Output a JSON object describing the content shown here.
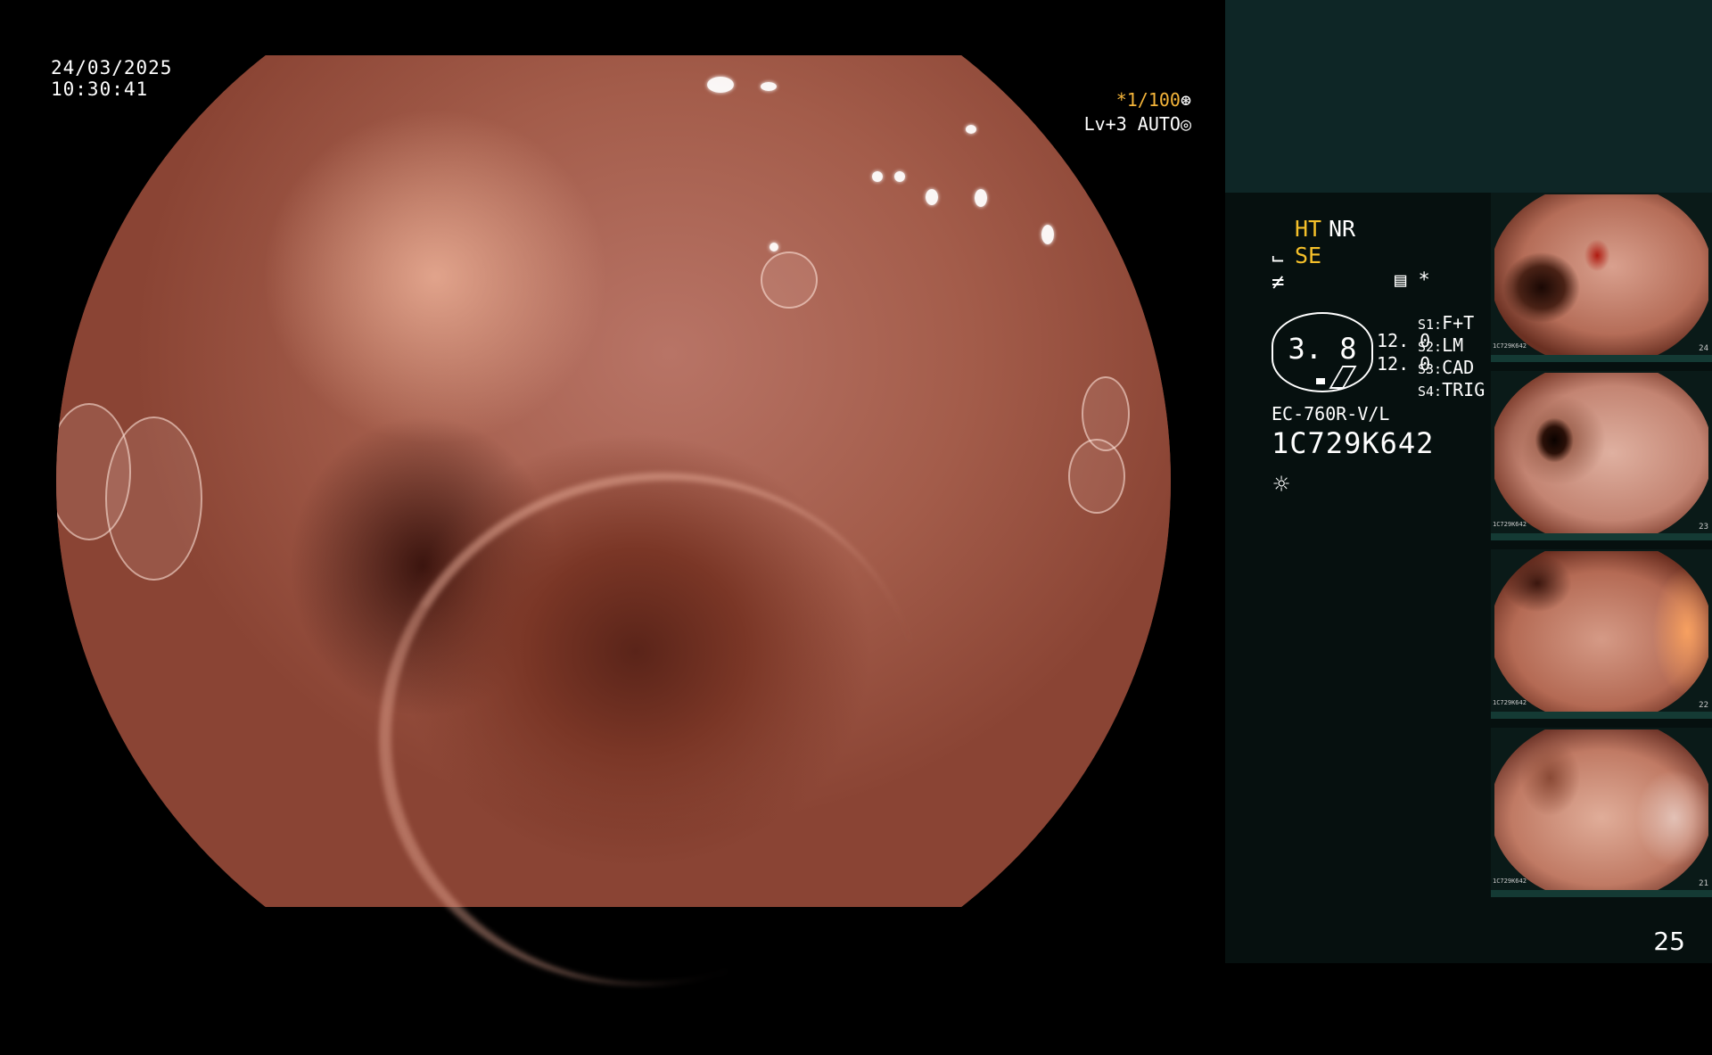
{
  "overlay": {
    "date": "24/03/2025",
    "time": "10:30:41",
    "shutter": "*1/100",
    "shutter_icon": "⊛",
    "level": "Lv+3 AUTO",
    "level_icon": "◎"
  },
  "panel": {
    "mode_ht": "HT",
    "mode_nr": "NR",
    "mode_se_icon": "⨽",
    "mode_se": "SE",
    "mode_f_icon": "≠",
    "icons": "▤ *",
    "gauge_value": "3. 8",
    "gauge_n1": "12. 0",
    "gauge_n2": "12. 0",
    "slots": [
      {
        "key": "S1:",
        "value": "F+T"
      },
      {
        "key": "S2:",
        "value": "LM"
      },
      {
        "key": "S3:",
        "value": "CAD"
      },
      {
        "key": "S4:",
        "value": "TRIG"
      }
    ],
    "scope_model": "EC-760R-V/L",
    "scope_serial": "1C729K642",
    "light_icon": "☼"
  },
  "thumbnails": [
    {
      "number": "24",
      "serial": "1C729K642"
    },
    {
      "number": "23",
      "serial": "1C729K642"
    },
    {
      "number": "22",
      "serial": "1C729K642"
    },
    {
      "number": "21",
      "serial": "1C729K642"
    }
  ],
  "page_number": "25",
  "colors": {
    "accent": "#f5c02a",
    "panel_top": "#0e2626",
    "panel_bg": "#06100f"
  }
}
